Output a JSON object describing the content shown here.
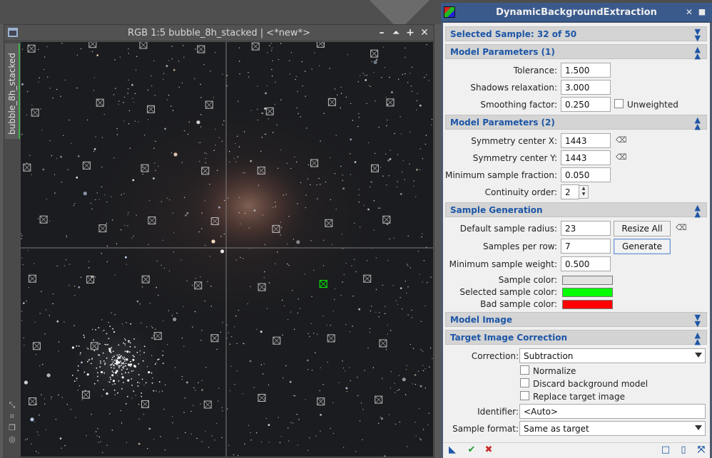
{
  "image_window": {
    "title": "RGB 1:5 bubble_8h_stacked | <*new*>",
    "side_tab": "bubble_8h_stacked",
    "buttons": [
      "–",
      "▲",
      "+",
      "✕"
    ]
  },
  "dbe": {
    "title": "DynamicBackgroundExtraction",
    "title_buttons": [
      "✕",
      "■"
    ],
    "selected_sample": {
      "label": "Selected Sample: 32 of 50"
    },
    "model_params_1": {
      "header": "Model Parameters (1)",
      "tolerance_label": "Tolerance:",
      "tolerance": "1.500",
      "shadows_label": "Shadows relaxation:",
      "shadows": "3.000",
      "smoothing_label": "Smoothing factor:",
      "smoothing": "0.250",
      "unweighted_label": "Unweighted"
    },
    "model_params_2": {
      "header": "Model Parameters (2)",
      "sym_x_label": "Symmetry center X:",
      "sym_x": "1443",
      "sym_y_label": "Symmetry center Y:",
      "sym_y": "1443",
      "min_frac_label": "Minimum sample fraction:",
      "min_frac": "0.050",
      "continuity_label": "Continuity order:",
      "continuity": "2"
    },
    "sample_generation": {
      "header": "Sample Generation",
      "radius_label": "Default sample radius:",
      "radius": "23",
      "resize_all": "Resize All",
      "per_row_label": "Samples per row:",
      "per_row": "7",
      "generate": "Generate",
      "min_weight_label": "Minimum sample weight:",
      "min_weight": "0.500",
      "sample_color_label": "Sample color:",
      "selected_color_label": "Selected sample color:",
      "bad_color_label": "Bad sample color:",
      "colors": {
        "sample": "#e2e2e2",
        "selected": "#00ff00",
        "bad": "#ff0000"
      }
    },
    "model_image": {
      "header": "Model Image"
    },
    "target_correction": {
      "header": "Target Image Correction",
      "correction_label": "Correction:",
      "correction": "Subtraction",
      "normalize": "Normalize",
      "discard": "Discard background model",
      "replace": "Replace target image",
      "identifier_label": "Identifier:",
      "identifier": "<Auto>",
      "format_label": "Sample format:",
      "format": "Same as target"
    }
  }
}
